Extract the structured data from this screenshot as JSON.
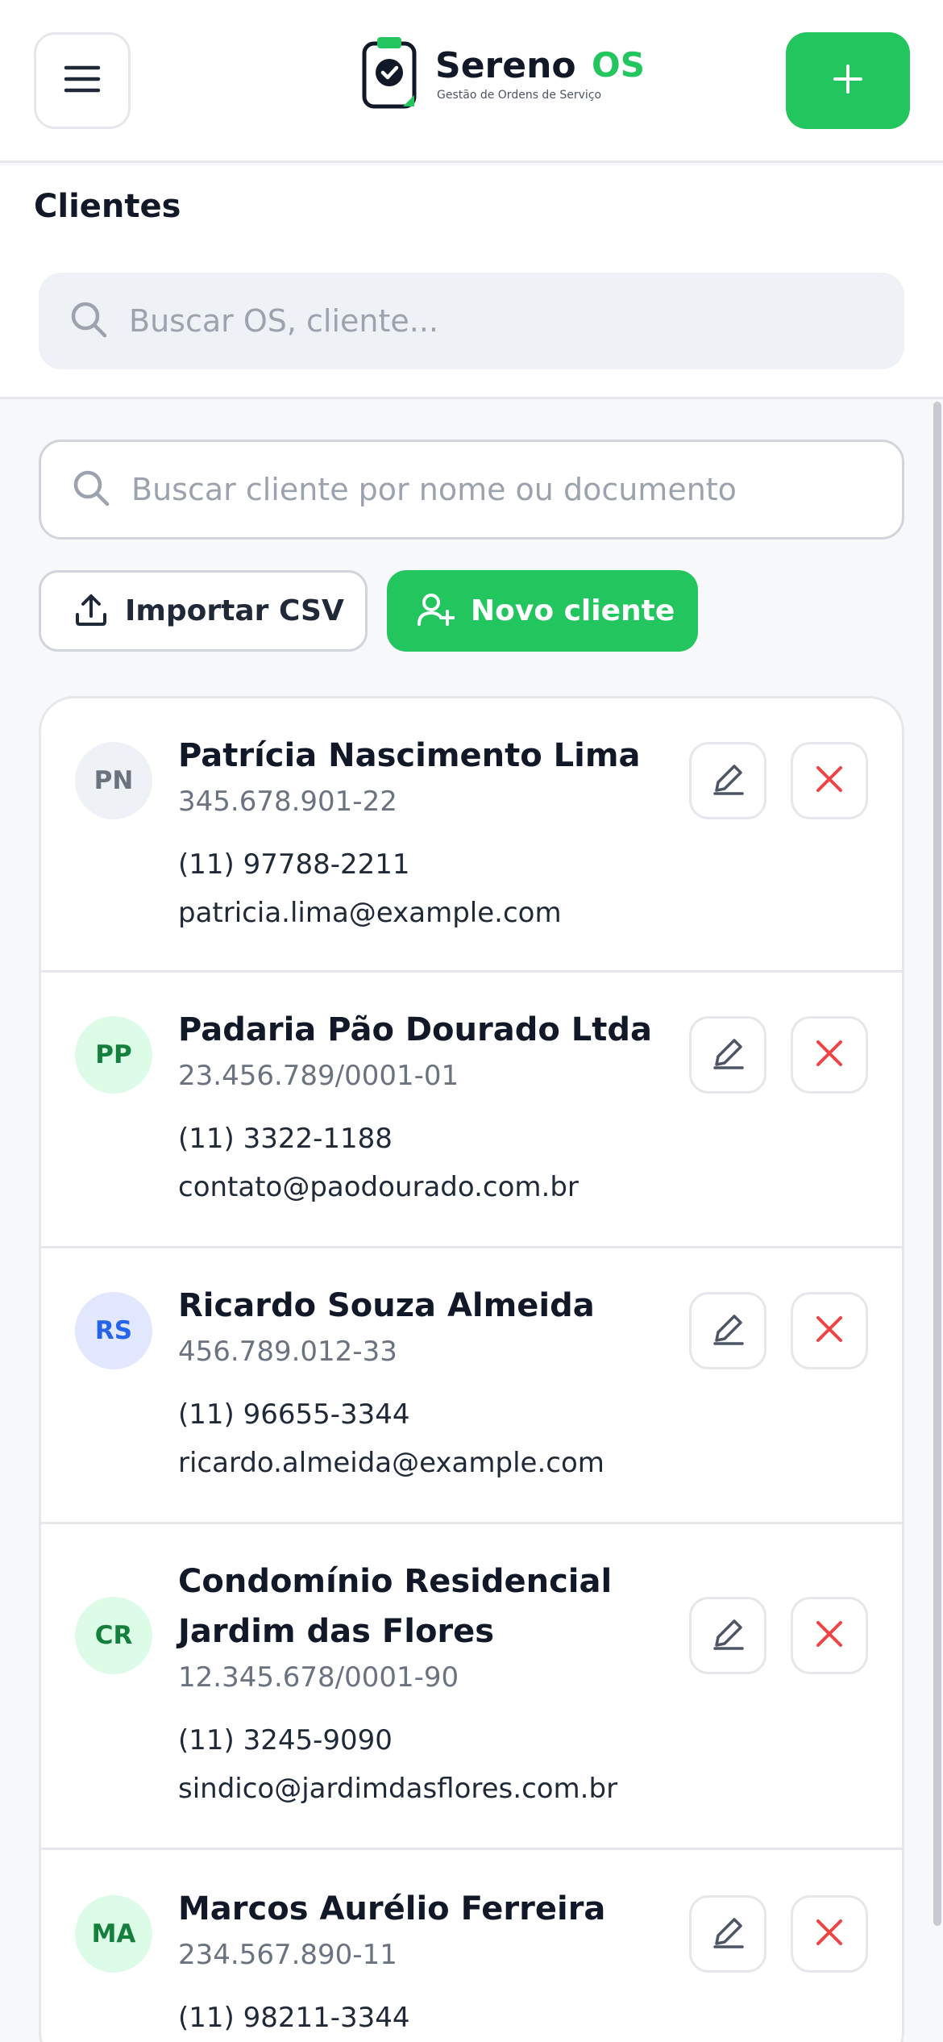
{
  "app": {
    "name": "Sereno",
    "name_suffix": "OS",
    "tagline": "Gestão de Ordens de Serviço"
  },
  "icons": {
    "menu": "hamburger-icon",
    "add": "plus-icon",
    "logo": "clipboard-check-icon",
    "search": "search-icon",
    "import": "upload-icon",
    "new_client": "user-plus-icon",
    "edit": "pencil-icon",
    "delete": "close-icon"
  },
  "colors": {
    "accent": "#22c55e",
    "danger": "#ef4444",
    "text": "#111827",
    "muted": "#6b7280"
  },
  "page": {
    "title": "Clientes"
  },
  "global_search": {
    "placeholder": "Buscar OS, cliente...",
    "value": ""
  },
  "client_search": {
    "placeholder": "Buscar cliente por nome ou documento",
    "value": ""
  },
  "actions": {
    "import_label": "Importar CSV",
    "new_label": "Novo cliente"
  },
  "clients": [
    {
      "initials": "PN",
      "name": "Patrícia Nascimento Lima",
      "document": "345.678.901-22",
      "phone": "(11) 97788-2211",
      "email": "patricia.lima@example.com",
      "avatar_bg": "#eef1f5",
      "avatar_fg": "#6b7280"
    },
    {
      "initials": "PP",
      "name": "Padaria Pão Dourado Ltda",
      "document": "23.456.789/0001-01",
      "phone": "(11) 3322-1188",
      "email": "contato@paodourado.com.br",
      "avatar_bg": "#dcfce7",
      "avatar_fg": "#15803d"
    },
    {
      "initials": "RS",
      "name": "Ricardo Souza Almeida",
      "document": "456.789.012-33",
      "phone": "(11) 96655-3344",
      "email": "ricardo.almeida@example.com",
      "avatar_bg": "#e0e7ff",
      "avatar_fg": "#2563eb"
    },
    {
      "initials": "CR",
      "name": "Condomínio Residencial Jardim das Flores",
      "document": "12.345.678/0001-90",
      "phone": "(11) 3245-9090",
      "email": "sindico@jardimdasflores.com.br",
      "avatar_bg": "#dcfce7",
      "avatar_fg": "#15803d"
    },
    {
      "initials": "MA",
      "name": "Marcos Aurélio Ferreira",
      "document": "234.567.890-11",
      "phone": "(11) 98211-3344",
      "email": "",
      "avatar_bg": "#dcfce7",
      "avatar_fg": "#15803d"
    }
  ]
}
